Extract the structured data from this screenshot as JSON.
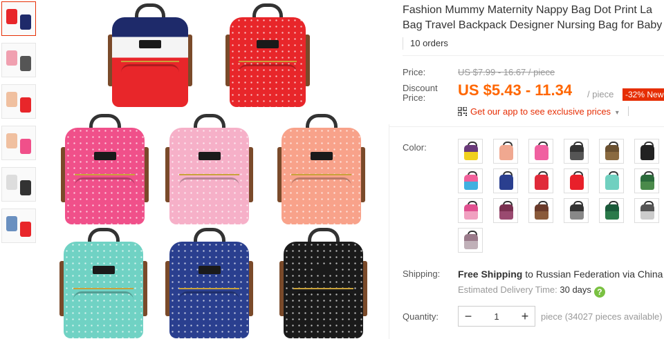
{
  "product": {
    "title_line1": "Fashion Mummy Maternity Nappy Bag Dot Print La",
    "title_line2": "Bag Travel Backpack Designer Nursing Bag for Baby",
    "orders": "10 orders"
  },
  "pricing": {
    "price_label": "Price:",
    "original_price": "US $7.99 - 16.67 / piece",
    "discount_label_line1": "Discount",
    "discount_label_line2": "Price:",
    "discount_price": "US $5.43 - 11.34",
    "per_piece": "/ piece",
    "badge": "-32% New",
    "app_promo": "Get our app to see exclusive prices",
    "app_caret": "▾"
  },
  "color": {
    "label": "Color:",
    "swatches": [
      {
        "top": "#6a3a7a",
        "bottom": "#f0d020"
      },
      {
        "top": "#f0a890",
        "bottom": "#f0a890"
      },
      {
        "top": "#f060a0",
        "bottom": "#f060a0"
      },
      {
        "top": "#333",
        "bottom": "#555"
      },
      {
        "top": "#6a5030",
        "bottom": "#8a6a40"
      },
      {
        "top": "#222",
        "bottom": "#222"
      },
      {
        "top": "#f0609a",
        "bottom": "#40b0e0"
      },
      {
        "top": "#2a3f8f",
        "bottom": "#2a3f8f"
      },
      {
        "top": "#e02a3a",
        "bottom": "#e02a3a"
      },
      {
        "top": "#e8202a",
        "bottom": "#e8202a"
      },
      {
        "top": "#70d0c0",
        "bottom": "#70d0c0"
      },
      {
        "top": "#2a6a3a",
        "bottom": "#4a8a4a"
      },
      {
        "top": "#e05090",
        "bottom": "#f0a0c0"
      },
      {
        "top": "#7a3050",
        "bottom": "#9a4a70"
      },
      {
        "top": "#6a3a2a",
        "bottom": "#8a5a3a"
      },
      {
        "top": "#333",
        "bottom": "#888"
      },
      {
        "top": "#1a5a3a",
        "bottom": "#2a7a4a"
      },
      {
        "top": "#555",
        "bottom": "#ccc"
      },
      {
        "top": "#9a7a8a",
        "bottom": "#c0b0b8"
      }
    ]
  },
  "shipping": {
    "label": "Shipping:",
    "free": "Free Shipping",
    "to": " to ",
    "destination": "Russian Federation via China",
    "estimated_label": "Estimated Delivery Time: ",
    "estimated_value": "30 days",
    "help_icon": "?"
  },
  "quantity": {
    "label": "Quantity:",
    "value": "1",
    "minus": "−",
    "plus": "+",
    "info": "piece (34027 pieces available)"
  },
  "gallery": {
    "bags": [
      {
        "name": "navy-white-red",
        "top": "#1e2a6a",
        "mid": "#f4f4f4",
        "bottom": "#e8262a"
      },
      {
        "name": "red",
        "top": "#e8262a",
        "mid": "#e8262a",
        "bottom": "#e8262a"
      },
      {
        "name": "hot-pink",
        "top": "#f0508a",
        "mid": "#f0508a",
        "bottom": "#f0508a"
      },
      {
        "name": "light-pink",
        "top": "#f6b0c8",
        "mid": "#f6b0c8",
        "bottom": "#f6b0c8"
      },
      {
        "name": "peach",
        "top": "#f8a28a",
        "mid": "#f8a28a",
        "bottom": "#f8a28a"
      },
      {
        "name": "mint",
        "top": "#70d2c4",
        "mid": "#70d2c4",
        "bottom": "#70d2c4"
      },
      {
        "name": "navy",
        "top": "#2a3f8f",
        "mid": "#2a3f8f",
        "bottom": "#2a3f8f"
      },
      {
        "name": "black",
        "top": "#1a1a1a",
        "mid": "#1a1a1a",
        "bottom": "#1a1a1a"
      }
    ]
  },
  "thumbnails": [
    {
      "c1": "#e8262a",
      "c2": "#1e2a6a"
    },
    {
      "c1": "#f0a0b0",
      "c2": "#555"
    },
    {
      "c1": "#f0c0a0",
      "c2": "#e8262a"
    },
    {
      "c1": "#f0c0a0",
      "c2": "#f0508a"
    },
    {
      "c1": "#ddd",
      "c2": "#333"
    },
    {
      "c1": "#6a90c0",
      "c2": "#e8262a"
    }
  ]
}
